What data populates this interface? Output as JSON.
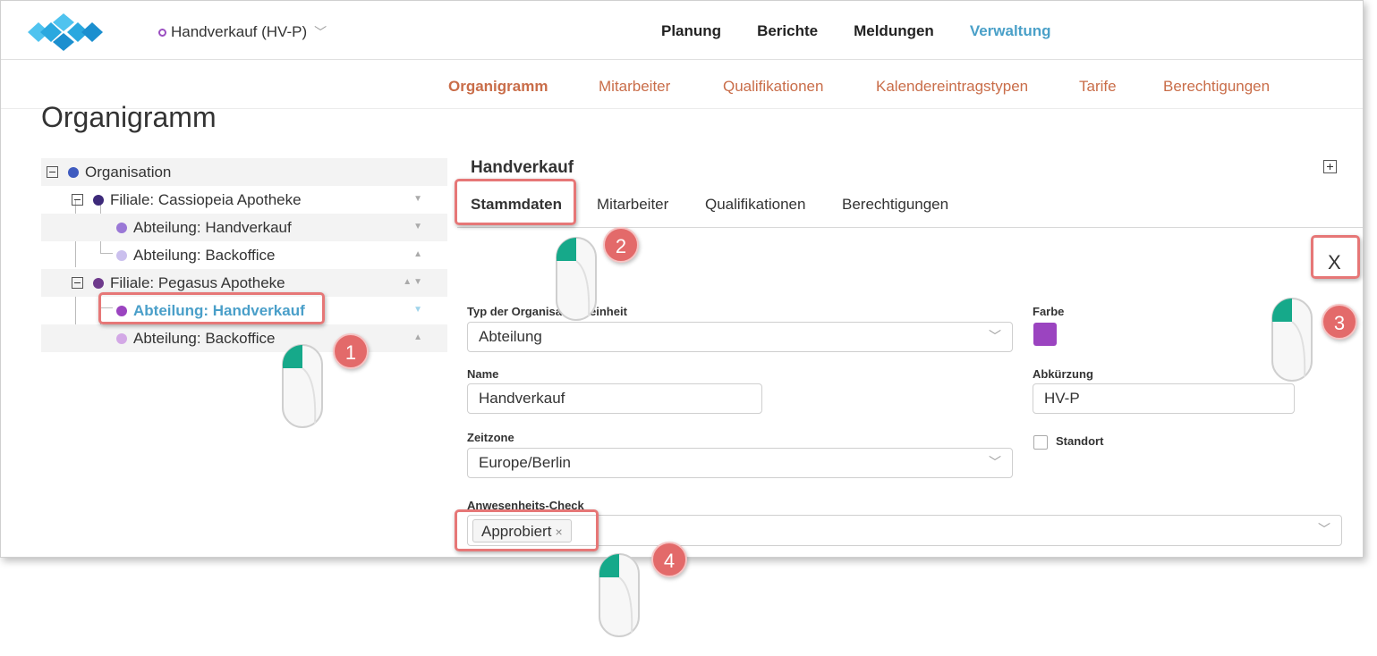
{
  "header": {
    "context_label": "Handverkauf (HV-P)",
    "nav": [
      "Planung",
      "Berichte",
      "Meldungen",
      "Verwaltung"
    ],
    "active_nav": "Verwaltung"
  },
  "subnav": {
    "items": [
      "Organigramm",
      "Mitarbeiter",
      "Qualifikationen",
      "Kalendereintragstypen",
      "Tarife",
      "Berechtigungen"
    ],
    "active": "Organigramm"
  },
  "page": {
    "title": "Organigramm"
  },
  "tree": {
    "rows": [
      {
        "label": "Organisation",
        "color": "#3f5bbf"
      },
      {
        "label": "Filiale: Cassiopeia Apotheke",
        "color": "#3d2a7a"
      },
      {
        "label": "Abteilung: Handverkauf",
        "color": "#9a78d6"
      },
      {
        "label": "Abteilung: Backoffice",
        "color": "#cbc0ee"
      },
      {
        "label": "Filiale: Pegasus Apotheke",
        "color": "#6e3a8c"
      },
      {
        "label": "Abteilung: Handverkauf",
        "color": "#9b44c0"
      },
      {
        "label": "Abteilung: Backoffice",
        "color": "#d3a8e6"
      }
    ]
  },
  "panel": {
    "title": "Handverkauf",
    "tabs": [
      "Stammdaten",
      "Mitarbeiter",
      "Qualifikationen",
      "Berechtigungen"
    ],
    "active_tab": "Stammdaten",
    "close_label": "X",
    "fields": {
      "type_label": "Typ der Organisationseinheit",
      "type_value": "Abteilung",
      "color_label": "Farbe",
      "color_value": "#9b44c0",
      "name_label": "Name",
      "name_value": "Handverkauf",
      "abbr_label": "Abkürzung",
      "abbr_value": "HV-P",
      "timezone_label": "Zeitzone",
      "timezone_value": "Europe/Berlin",
      "location_label": "Standort",
      "presence_label": "Anwesenheits-Check",
      "presence_chip": "Approbiert",
      "presence_chip_remove": "×"
    }
  },
  "annotations": {
    "steps": [
      "1",
      "2",
      "3",
      "4"
    ]
  },
  "colors": {
    "accent_blue": "#4aa0c8",
    "subnav_orange": "#c96d49",
    "highlight_red": "#e67777",
    "step_badge": "#e36a6a"
  }
}
